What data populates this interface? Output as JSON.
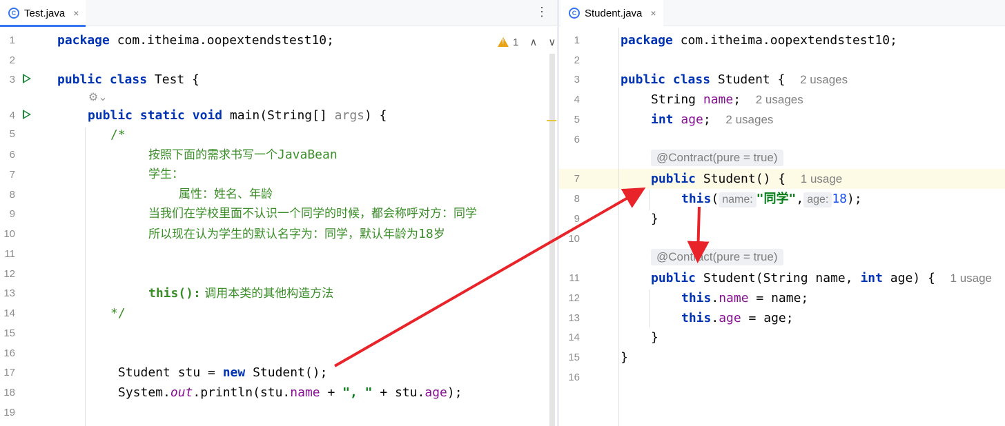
{
  "left_editor": {
    "tab": {
      "icon": "class-icon",
      "title": "Test.java",
      "close": "×"
    },
    "more_menu": "⋮",
    "warnings": {
      "count": "1",
      "up": "∧",
      "down": "∨"
    },
    "lines": [
      {
        "n": "1"
      },
      {
        "n": "2"
      },
      {
        "n": "3"
      },
      {
        "n": "4"
      },
      {
        "n": "5"
      },
      {
        "n": "6"
      },
      {
        "n": "7"
      },
      {
        "n": "8"
      },
      {
        "n": "9"
      },
      {
        "n": "10"
      },
      {
        "n": "11"
      },
      {
        "n": "12"
      },
      {
        "n": "13"
      },
      {
        "n": "14"
      },
      {
        "n": "15"
      },
      {
        "n": "16"
      },
      {
        "n": "17"
      },
      {
        "n": "18"
      },
      {
        "n": "19"
      }
    ],
    "code": {
      "pkg_kw": "package",
      "pkg_name": " com.itheima.oopextendstest10;",
      "pub": "public",
      "cls": " class",
      "test_name": " Test {",
      "pub2": "public",
      "static": " static",
      "void": " void",
      "main_sig": " main(String[] ",
      "args": "args",
      ") {": ") {",
      "c_open": "/*",
      "c1": "按照下面的需求书写一个",
      "c1b": "JavaBean",
      "c2": "学生：",
      "c3": "属性：姓名、年龄",
      "c4": "当我们在学校里面不认识一个同学的时候，都会称呼对方：同学",
      "c5": "所以现在认为学生的默认名字为：同学，默认年龄为",
      "c5b": "18",
      "c5c": "岁",
      "c6a": "this():",
      "c6b": " 调用本类的其他构造方法",
      "c_close": "*/",
      "l17a": "Student stu = ",
      "l17new": "new",
      "l17b": " Student();",
      "l18a": "System.",
      "l18out": "out",
      "l18b": ".println(stu.",
      "l18name": "name",
      "l18c": " + ",
      "l18str": "\", \"",
      "l18d": " + stu.",
      "l18age": "age",
      "l18e": ");"
    }
  },
  "right_editor": {
    "tab": {
      "icon": "class-icon",
      "title": "Student.java",
      "close": "×"
    },
    "code": {
      "pkg_kw": "package",
      "pkg_name": " com.itheima.oopextendstest10;",
      "pub": "public",
      "cls": " class",
      "cls_name": " Student {",
      "usages2": "2 usages",
      "string": "String ",
      "name": "name",
      ";": ";",
      "usages_name": "2 usages",
      "int": "int",
      "age": "age",
      "usages_age": "2 usages",
      "anno": "@Contract(pure = true)",
      "ctor1_kw": "public",
      "ctor1": " Student() {",
      "usage1": "1 usage",
      "this": "this",
      "hint_name": "name:",
      "str_tx": "\"同学\"",
      "hint_age": "age:",
      "num18": "18",
      "close_call": ");",
      "brace": "}",
      "anno2": "@Contract(pure = true)",
      "ctor2_kw": "public",
      "ctor2a": " Student(String name, ",
      "ctor2_int": "int",
      "ctor2b": " age) {",
      "usage_ctor2": "1 usage",
      "this2": "this",
      ".name": ".",
      "fname": "name",
      "asg_name": " = name;",
      "this3": "this",
      "fage": "age",
      "asg_age": " = age;",
      "brace2": "}",
      "brace3": "}"
    },
    "line_numbers": [
      "1",
      "2",
      "3",
      "4",
      "5",
      "6",
      "7",
      "8",
      "9",
      "10",
      "11",
      "12",
      "13",
      "14",
      "15",
      "16"
    ]
  },
  "annotations": {
    "arrow_color": "#e8242a"
  }
}
